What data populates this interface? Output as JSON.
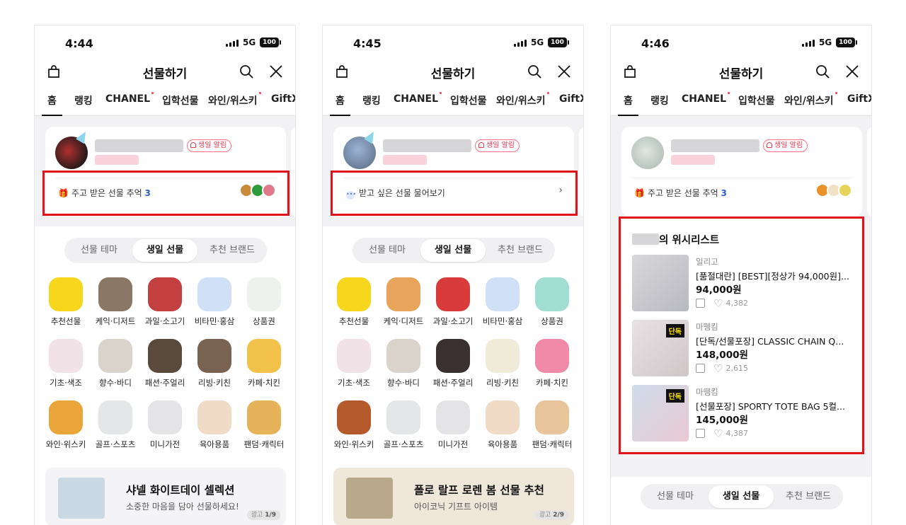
{
  "common": {
    "network": "5G",
    "battery": "100",
    "title": "선물하기",
    "tabs": [
      "홈",
      "랭킹",
      "CHANEL",
      "입학선물",
      "와인/위스키",
      "GiftX"
    ],
    "birthday_badge": "생일 알림",
    "segments": [
      "선물 테마",
      "생일 선물",
      "추천 브랜드"
    ]
  },
  "screens": [
    {
      "time": "4:44",
      "card_text": "주고 받은 선물 추억",
      "card_count": "3",
      "categories_row1": [
        "추천선물",
        "케익·디저트",
        "과일·소고기",
        "비타민·홍삼",
        "상품권"
      ],
      "categories_row2": [
        "기초·색조",
        "향수·바디",
        "패션·주얼리",
        "리빙·키친",
        "카페·치킨"
      ],
      "categories_row3": [
        "와인·위스키",
        "골프·스포츠",
        "미니가전",
        "육아용품",
        "팬덤·캐릭터"
      ],
      "banner": {
        "title": "샤넬 화이트데이 셀렉션",
        "subtitle": "소중한 마음을 담아 선물하세요!",
        "ad": "광고",
        "page": "1/9"
      }
    },
    {
      "time": "4:45",
      "card_text": "받고 싶은 선물 물어보기",
      "categories_row1": [
        "추천선물",
        "케익·디저트",
        "과일·소고기",
        "비타민·홍삼",
        "상품권"
      ],
      "categories_row2": [
        "기초·색조",
        "향수·바디",
        "패션·주얼리",
        "리빙·키친",
        "카페·치킨"
      ],
      "categories_row3": [
        "와인·위스키",
        "골프·스포츠",
        "미니가전",
        "육아용품",
        "팬덤·캐릭터"
      ],
      "banner": {
        "title": "폴로 랄프 로렌 봄 선물 추천",
        "subtitle": "아이코닉 기프트 아이템",
        "ad": "광고",
        "page": "2/9"
      }
    },
    {
      "time": "4:46",
      "card_text": "주고 받은 선물 추억",
      "card_count": "3",
      "wishlist_title": "의 위시리스트",
      "wishlist": [
        {
          "brand": "일리고",
          "name": "[품절대란] [BEST][정상가 94,000원]...",
          "price": "94,000원",
          "likes": "4,382",
          "exclusive": ""
        },
        {
          "brand": "마뗑킴",
          "name": "[단독/선물포장] CLASSIC CHAIN Q...",
          "price": "148,000원",
          "likes": "2,615",
          "exclusive": "단독"
        },
        {
          "brand": "마뗑킴",
          "name": "[선물포장] SPORTY TOTE BAG 5컬...",
          "price": "145,000원",
          "likes": "4,387",
          "exclusive": "단독"
        }
      ]
    }
  ],
  "colors": {
    "highlight": "#e0121b",
    "accent_pink": "#ff3a52",
    "count_blue": "#2a5bd7"
  }
}
